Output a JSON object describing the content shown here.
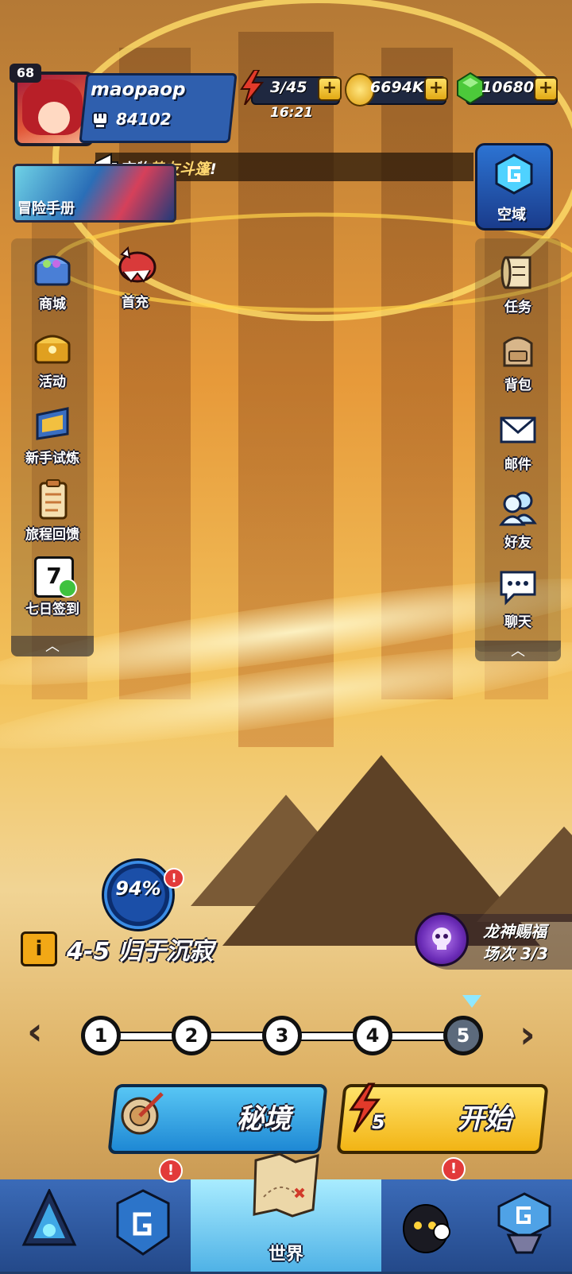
{
  "player": {
    "level": "68",
    "name": "maopaop",
    "power": "84102"
  },
  "resources": {
    "energy": "3/45",
    "energy_timer": "16:21",
    "gold": "6694K",
    "gems": "10680",
    "add_symbol": "+"
  },
  "announcement": {
    "prefix": "宝物",
    "highlight": "挚友斗篷",
    "suffix": "!"
  },
  "adventure_manual": {
    "label": "冒险手册"
  },
  "sky_realm": {
    "label": "空域"
  },
  "left_menu": [
    {
      "label": "商城",
      "icon": "treasure-chest-icon"
    },
    {
      "label": "活动",
      "icon": "gold-chest-icon"
    },
    {
      "label": "新手试炼",
      "icon": "shield-book-icon"
    },
    {
      "label": "旅程回馈",
      "icon": "clipboard-icon"
    },
    {
      "label": "七日签到",
      "icon": "calendar-icon",
      "badge_number": "7"
    }
  ],
  "first_recharge": {
    "label": "首充"
  },
  "right_menu": [
    {
      "label": "任务",
      "icon": "scroll-icon"
    },
    {
      "label": "背包",
      "icon": "backpack-icon"
    },
    {
      "label": "邮件",
      "icon": "mail-icon"
    },
    {
      "label": "好友",
      "icon": "friends-icon"
    },
    {
      "label": "聊天",
      "icon": "chat-icon"
    }
  ],
  "collapse_symbol": "︿",
  "progress": {
    "value": "94%",
    "alert": "!"
  },
  "stage": {
    "info_symbol": "i",
    "title": "4-5 归于沉寂"
  },
  "dragon_blessing": {
    "line1": "龙神赐福",
    "line2": "场次 3/3"
  },
  "stage_nodes": [
    "1",
    "2",
    "3",
    "4",
    "5"
  ],
  "current_node": "5",
  "nav_arrows": {
    "prev": "‹",
    "next": "›"
  },
  "actions": {
    "secret_realm": "秘境",
    "start": "开始",
    "start_cost": "5"
  },
  "bottom_nav": {
    "active_label": "世界",
    "alert": "!"
  },
  "colors": {
    "accent_blue": "#2f5fae",
    "gold": "#f2b414",
    "alert_red": "#e23a3a",
    "gem_green": "#4cc93a"
  }
}
